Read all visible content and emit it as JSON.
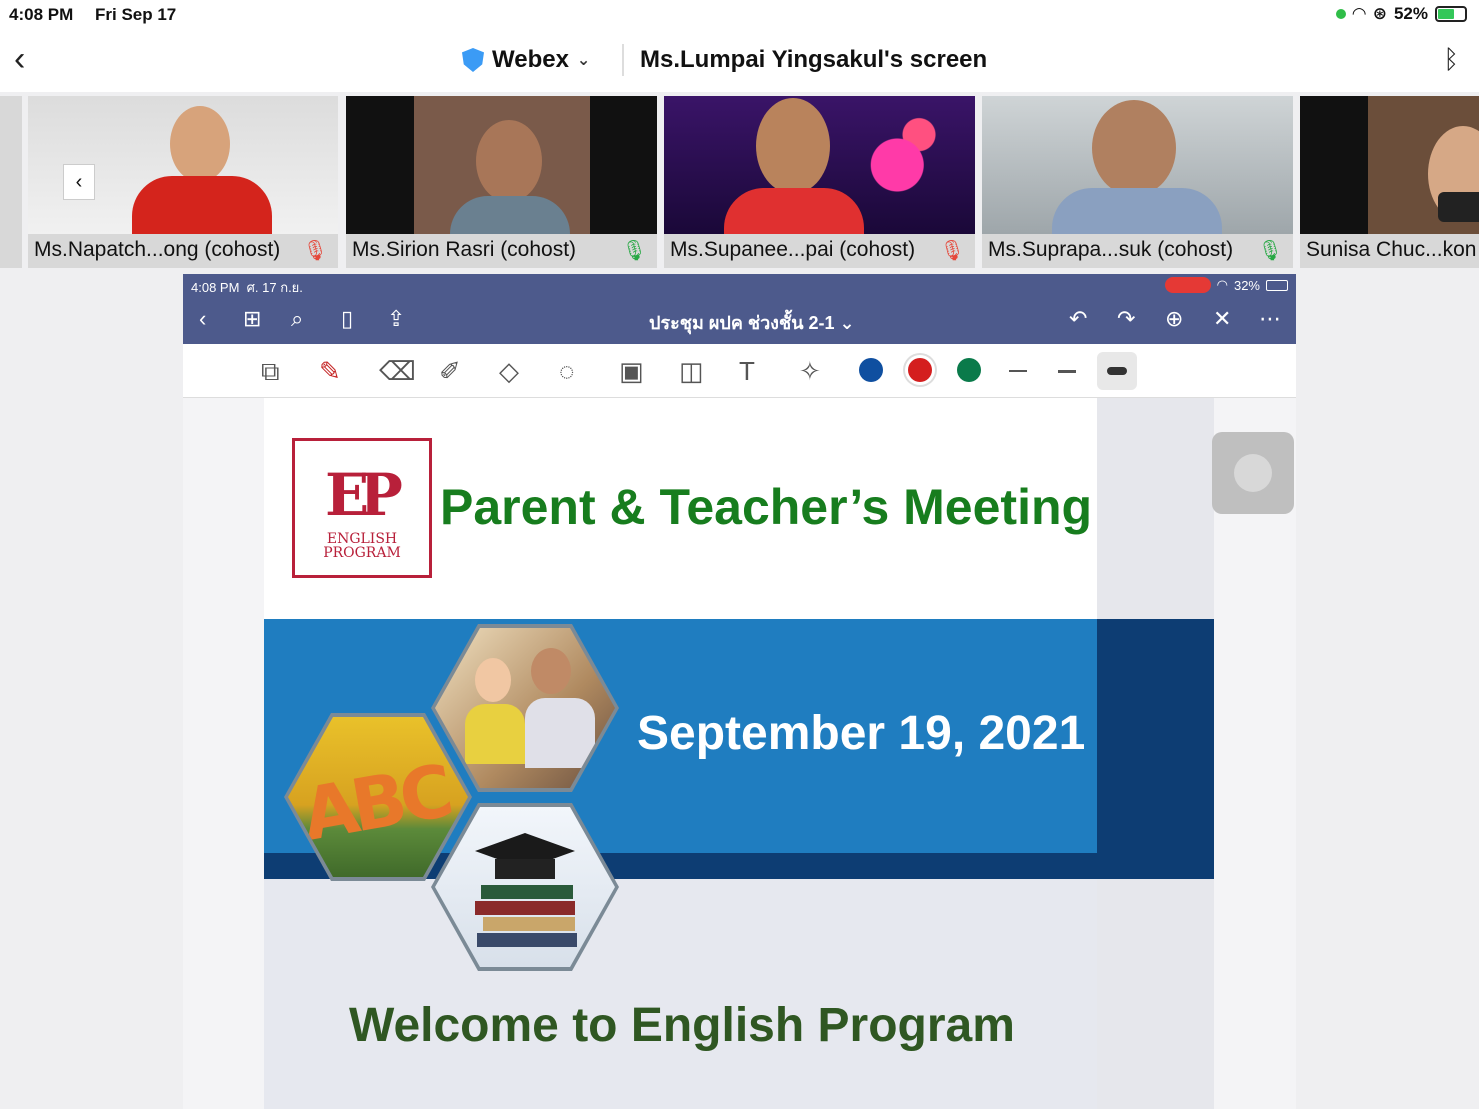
{
  "status_bar": {
    "time": "4:08 PM",
    "date": "Fri Sep 17",
    "battery": "52%"
  },
  "header": {
    "app_name": "Webex",
    "share_title": "Ms.Lumpai Yingsakul's screen"
  },
  "participants": [
    {
      "name": "Ms.Napatch...ong (cohost)",
      "muted": true
    },
    {
      "name": "Ms.Sirion Rasri (cohost)",
      "muted": false
    },
    {
      "name": "Ms.Supanee...pai (cohost)",
      "muted": true
    },
    {
      "name": "Ms.Suprapa...suk (cohost)",
      "muted": false
    },
    {
      "name": "Sunisa Chuc...kon",
      "muted": false
    }
  ],
  "shared_screen": {
    "status": {
      "time": "4:08 PM",
      "date": "ศ. 17 ก.ย.",
      "battery": "32%"
    },
    "doc_title": "ประชุม ผปค ช่วงชั้น 2-1",
    "colors": {
      "blue": "#0f4fa0",
      "red": "#d41e1e",
      "green": "#0a7a4a"
    }
  },
  "slide": {
    "logo_line1": "ENGLISH",
    "logo_line2": "PROGRAM",
    "title": "Parent & Teacher’s Meeting",
    "date": "September 19, 2021",
    "welcome": "Welcome to English Program"
  }
}
